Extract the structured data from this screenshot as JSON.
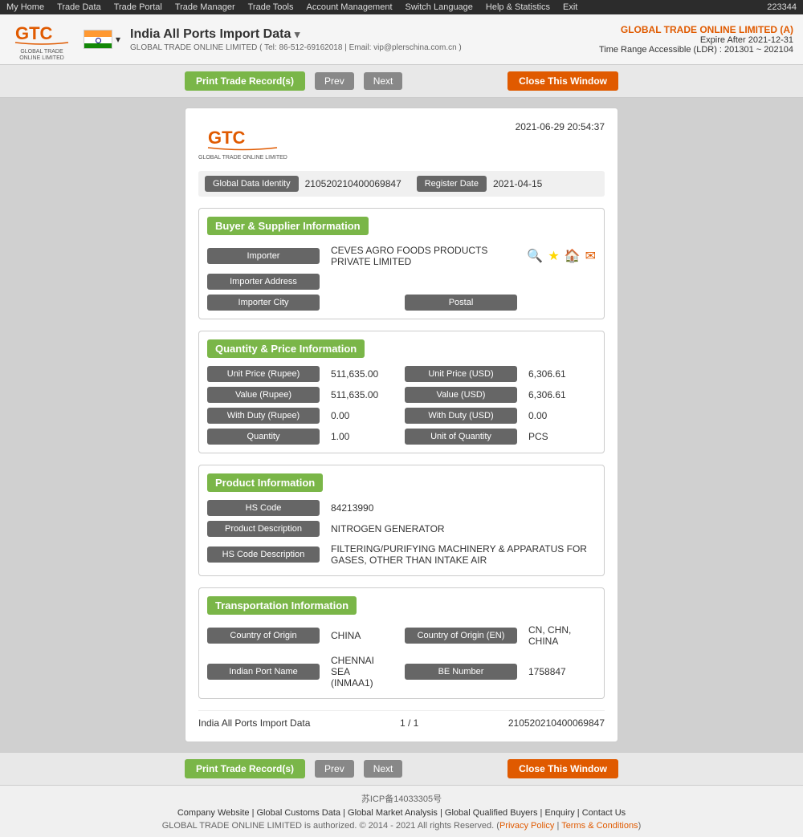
{
  "topbar": {
    "nav_items": [
      "My Home",
      "Trade Data",
      "Trade Portal",
      "Trade Manager",
      "Trade Tools",
      "Account Management",
      "Switch Language",
      "Help & Statistics",
      "Exit"
    ],
    "user_id": "223344"
  },
  "header": {
    "logo_text": "GTC",
    "logo_tagline": "GLOBAL TRADE ONLINE LIMITED",
    "title": "India All Ports Import Data",
    "subtitle": "GLOBAL TRADE ONLINE LIMITED ( Tel: 86-512-69162018 | Email: vip@plerschina.com.cn )",
    "company_name": "GLOBAL TRADE ONLINE LIMITED (A)",
    "expire_label": "Expire After 2021-12-31",
    "time_range": "Time Range Accessible (LDR) : 201301 ~ 202104"
  },
  "toolbar": {
    "print_label": "Print Trade Record(s)",
    "prev_label": "Prev",
    "next_label": "Next",
    "close_label": "Close This Window"
  },
  "record": {
    "timestamp": "2021-06-29 20:54:37",
    "global_data_identity_label": "Global Data Identity",
    "global_data_identity_value": "210520210400069847",
    "register_date_label": "Register Date",
    "register_date_value": "2021-04-15",
    "buyer_supplier_header": "Buyer & Supplier Information",
    "importer_label": "Importer",
    "importer_value": "CEVES AGRO FOODS PRODUCTS PRIVATE LIMITED",
    "importer_address_label": "Importer Address",
    "importer_address_value": "",
    "importer_city_label": "Importer City",
    "importer_city_value": "",
    "postal_label": "Postal",
    "postal_value": "",
    "quantity_price_header": "Quantity & Price Information",
    "unit_price_rupee_label": "Unit Price (Rupee)",
    "unit_price_rupee_value": "511,635.00",
    "unit_price_usd_label": "Unit Price (USD)",
    "unit_price_usd_value": "6,306.61",
    "value_rupee_label": "Value (Rupee)",
    "value_rupee_value": "511,635.00",
    "value_usd_label": "Value (USD)",
    "value_usd_value": "6,306.61",
    "with_duty_rupee_label": "With Duty (Rupee)",
    "with_duty_rupee_value": "0.00",
    "with_duty_usd_label": "With Duty (USD)",
    "with_duty_usd_value": "0.00",
    "quantity_label": "Quantity",
    "quantity_value": "1.00",
    "unit_of_quantity_label": "Unit of Quantity",
    "unit_of_quantity_value": "PCS",
    "product_header": "Product Information",
    "hs_code_label": "HS Code",
    "hs_code_value": "84213990",
    "product_desc_label": "Product Description",
    "product_desc_value": "NITROGEN GENERATOR",
    "hs_code_desc_label": "HS Code Description",
    "hs_code_desc_value": "FILTERING/PURIFYING MACHINERY & APPARATUS FOR GASES, OTHER THAN INTAKE AIR",
    "transport_header": "Transportation Information",
    "country_origin_label": "Country of Origin",
    "country_origin_value": "CHINA",
    "country_origin_en_label": "Country of Origin (EN)",
    "country_origin_en_value": "CN, CHN, CHINA",
    "indian_port_label": "Indian Port Name",
    "indian_port_value": "CHENNAI SEA (INMAA1)",
    "be_number_label": "BE Number",
    "be_number_value": "1758847",
    "footer_source": "India All Ports Import Data",
    "footer_page": "1 / 1",
    "footer_id": "210520210400069847"
  },
  "footer": {
    "icp": "苏ICP备14033305号",
    "links": [
      "Company Website",
      "Global Customs Data",
      "Global Market Analysis",
      "Global Qualified Buyers",
      "Enquiry",
      "Contact Us"
    ],
    "copyright": "GLOBAL TRADE ONLINE LIMITED is authorized. © 2014 - 2021 All rights Reserved.",
    "privacy_label": "Privacy Policy",
    "terms_label": "Terms & Conditions"
  }
}
